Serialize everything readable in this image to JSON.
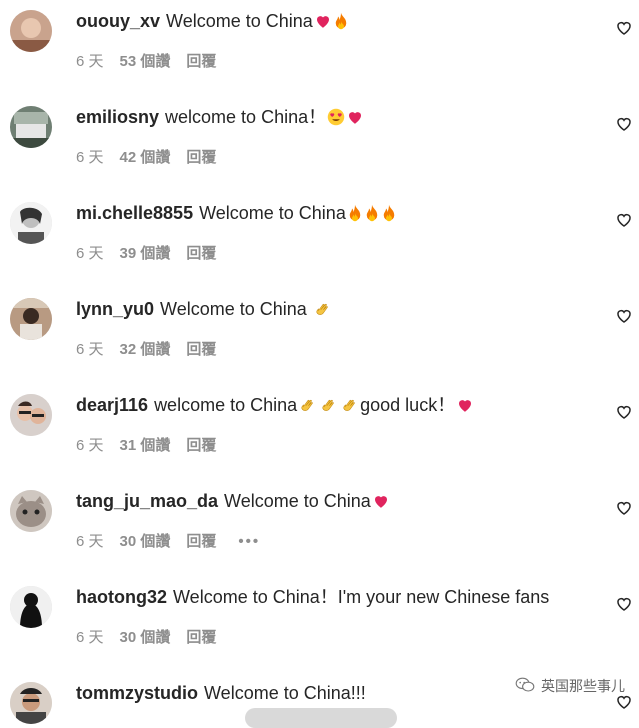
{
  "comments": [
    {
      "username": "ououy_xv",
      "text": "Welcome to China",
      "time": "6 天",
      "likes": "53 個讚",
      "reply": "回覆",
      "emojis": [
        "heart",
        "fire"
      ]
    },
    {
      "username": "emiliosny",
      "text": "welcome to China！",
      "time": "6 天",
      "likes": "42 個讚",
      "reply": "回覆",
      "emojis": [
        "heart-eyes",
        "heart"
      ]
    },
    {
      "username": "mi.chelle8855",
      "text": "Welcome to China",
      "time": "6 天",
      "likes": "39 個讚",
      "reply": "回覆",
      "emojis": [
        "fire",
        "fire",
        "fire"
      ]
    },
    {
      "username": "lynn_yu0",
      "text": "Welcome to China ",
      "time": "6 天",
      "likes": "32 個讚",
      "reply": "回覆",
      "emojis": [
        "clap"
      ]
    },
    {
      "username": "dearj116",
      "text": "welcome to China",
      "text2": "good luck！",
      "time": "6 天",
      "likes": "31 個讚",
      "reply": "回覆",
      "emojis": [
        "clap",
        "clap",
        "clap"
      ],
      "emojis2": [
        "heart"
      ]
    },
    {
      "username": "tang_ju_mao_da",
      "text": "Welcome to China",
      "time": "6 天",
      "likes": "30 個讚",
      "reply": "回覆",
      "more": "•••",
      "emojis": [
        "heart"
      ]
    },
    {
      "username": "haotong32",
      "text": "Welcome to China！I'm your new Chinese fans",
      "time": "6 天",
      "likes": "30 個讚",
      "reply": "回覆",
      "emojis": []
    },
    {
      "username": "tommzystudio",
      "text": "Welcome to China!!!",
      "emojis": []
    }
  ],
  "watermark": {
    "text": "英国那些事儿",
    "icon": "wechat-icon"
  },
  "icons": {
    "like": "heart-outline-icon"
  }
}
